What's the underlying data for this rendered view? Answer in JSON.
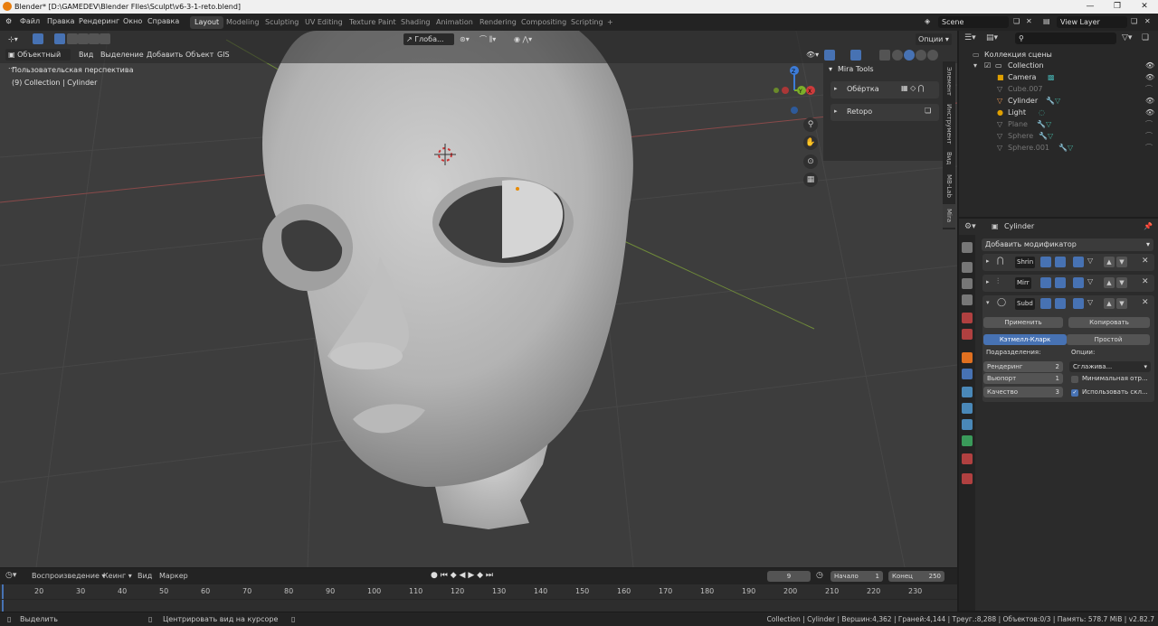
{
  "window": {
    "title": "Blender* [D:\\GAMEDEV\\Blender FIles\\Sculpt\\v6-3-1-reto.blend]"
  },
  "menu": [
    "Файл",
    "Правка",
    "Рендеринг",
    "Окно",
    "Справка"
  ],
  "workspaces": [
    "Layout",
    "Modeling",
    "Sculpting",
    "UV Editing",
    "Texture Paint",
    "Shading",
    "Animation",
    "Rendering",
    "Compositing",
    "Scripting",
    "+"
  ],
  "scene": {
    "name": "Scene",
    "view_layer": "View Layer"
  },
  "viewport": {
    "toolbar": {
      "orientation": "Глоба...",
      "options": "Опции"
    },
    "header": {
      "mode": "Объектный ...",
      "items": [
        "Вид",
        "Выделение",
        "Добавить",
        "Объект",
        "GIS"
      ]
    },
    "info_line1": "Пользовательская перспектива",
    "info_line2": "(9) Collection | Cylinder",
    "gizmo": {
      "z": "Z",
      "y": "Y",
      "x": "X"
    },
    "nav_icons": [
      "zoom-icon",
      "hand-icon",
      "camera-icon",
      "grid-icon"
    ]
  },
  "npanel": {
    "title": "Mira Tools",
    "rows": [
      "Обёртка",
      "Retopo"
    ],
    "tabs": [
      "Элемент",
      "Инструмент",
      "Вид",
      "MB-Lab",
      "Mira"
    ]
  },
  "outliner": {
    "root": "Коллекция сцены",
    "collection": "Collection",
    "items": [
      {
        "name": "Camera",
        "color": "#e0a000",
        "dim": false
      },
      {
        "name": "Cube.007",
        "color": "#888888",
        "dim": true
      },
      {
        "name": "Cylinder",
        "color": "#e09050",
        "dim": false
      },
      {
        "name": "Light",
        "color": "#e0a000",
        "dim": false
      },
      {
        "name": "Plane",
        "color": "#888888",
        "dim": true
      },
      {
        "name": "Sphere",
        "color": "#888888",
        "dim": true
      },
      {
        "name": "Sphere.001",
        "color": "#888888",
        "dim": true
      }
    ]
  },
  "properties": {
    "object": "Cylinder",
    "add_modifier": "Добавить модификатор",
    "modifiers": [
      "Shrin",
      "Mirr",
      "Subd"
    ],
    "apply": "Применить",
    "copy": "Копировать",
    "type_catmull": "Кэтмелл-Кларк",
    "type_simple": "Простой",
    "subdivisions_label": "Подразделения:",
    "options_label": "Опции:",
    "render_label": "Рендеринг",
    "render_value": "2",
    "viewport_label": "Вьюпорт",
    "viewport_value": "1",
    "quality_label": "Качество",
    "quality_value": "3",
    "smooth_select": "Сглажива...",
    "min_vertices": "Минимальная отр...",
    "use_creases": "Использовать скл..."
  },
  "timeline": {
    "playback": "Воспроизведение",
    "keying": "Кеинг",
    "view": "Вид",
    "marker": "Маркер",
    "current_frame": "9",
    "start_label": "Начало",
    "start": "1",
    "end_label": "Конец",
    "end": "250",
    "ticks": [
      "20",
      "30",
      "40",
      "50",
      "60",
      "70",
      "80",
      "90",
      "100",
      "110",
      "120",
      "130",
      "140",
      "150",
      "160",
      "170",
      "180",
      "190",
      "200",
      "210",
      "220",
      "230"
    ]
  },
  "status": {
    "select": "Выделить",
    "center": "Центрировать вид на курсоре",
    "info": "Collection | Cylinder | Вершин:4,362 | Граней:4,144 | Треуг.:8,288 | Объектов:0/3 | Память: 578.7 MiB | v2.82.7"
  }
}
